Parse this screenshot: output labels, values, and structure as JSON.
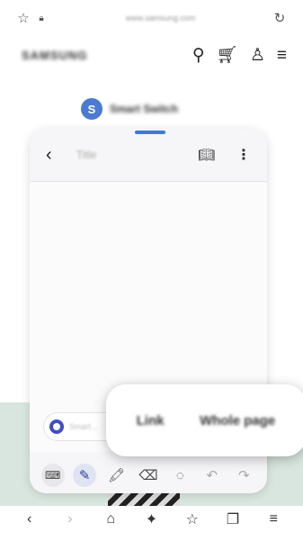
{
  "browser": {
    "url": "www.samsung.com",
    "icons": [
      "bookmark-star-icon",
      "lock-icon",
      "refresh-icon"
    ]
  },
  "site": {
    "logo_text": "SAMSUNG",
    "icons": [
      "search-icon",
      "cart-icon",
      "account-icon",
      "menu-icon"
    ]
  },
  "app": {
    "logo_glyph": "S",
    "title": "Smart Switch"
  },
  "note": {
    "back_glyph": "‹",
    "title_placeholder": "Title",
    "input_text": "Smart...",
    "accent_color": "#3d7bd9"
  },
  "toolbar": {
    "tools": [
      "keyboard-icon",
      "pen-icon",
      "highlighter-icon",
      "eraser-icon",
      "lasso-icon",
      "undo-icon",
      "redo-icon"
    ]
  },
  "popup": {
    "options": [
      "Link",
      "Whole page"
    ]
  },
  "bottom_nav": {
    "items": [
      "back-icon",
      "forward-icon",
      "home-icon",
      "magic-icon",
      "bookmarks-icon",
      "tabs-icon",
      "menu-icon"
    ]
  }
}
